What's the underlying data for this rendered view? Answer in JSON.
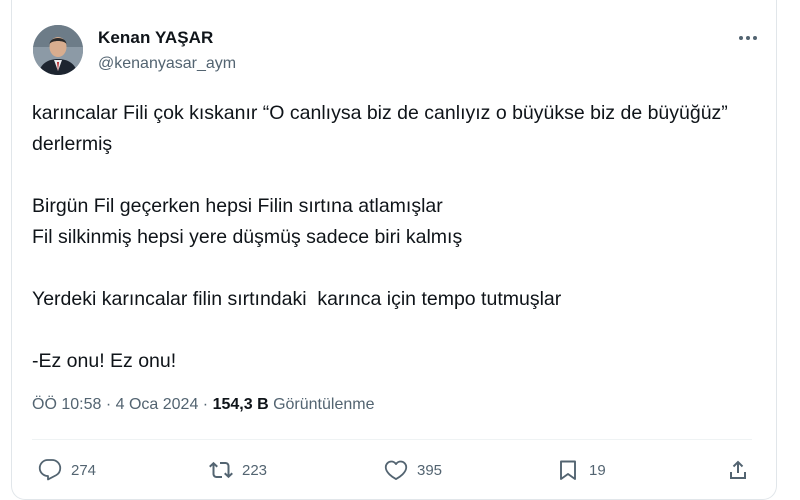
{
  "author": {
    "name": "Kenan YAŞAR",
    "handle": "@kenanyasar_aym"
  },
  "tweet": {
    "paragraphs": [
      "karıncalar Fili çok kıskanır “O canlıysa biz de canlıyız o büyükse biz de büyüğüz” derlermiş",
      "Birgün Fil geçerken hepsi Filin sırtına atlamışlar\nFil silkinmiş hepsi yere düşmüş sadece biri kalmış",
      "Yerdeki karıncalar filin sırtındaki  karınca için tempo tutmuşlar",
      "-Ez onu! Ez onu!"
    ]
  },
  "meta": {
    "time": "ÖÖ 10:58",
    "sep1": "·",
    "date": "4 Oca 2024",
    "sep2": "·",
    "views": "154,3 B",
    "views_label": "Görüntülenme"
  },
  "actions": {
    "replies": "274",
    "reposts": "223",
    "likes": "395",
    "bookmarks": "19"
  },
  "icons": {
    "more": "more-horizontal-icon",
    "reply": "reply-icon",
    "repost": "repost-icon",
    "like": "heart-icon",
    "bookmark": "bookmark-icon",
    "share": "share-icon"
  }
}
